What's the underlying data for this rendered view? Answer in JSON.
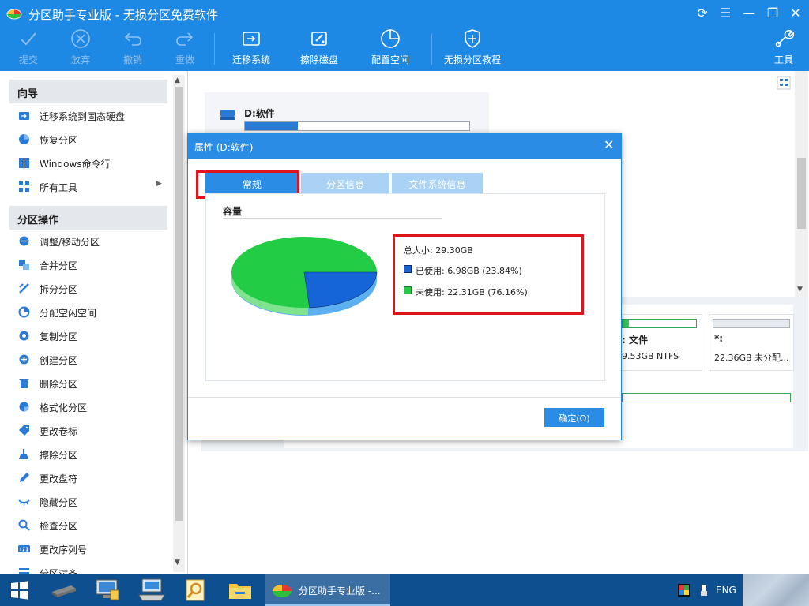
{
  "window": {
    "title": "分区助手专业版 - 无损分区免费软件"
  },
  "toolbar": {
    "items": [
      {
        "label": "提交",
        "icon": "check-icon",
        "disabled": true
      },
      {
        "label": "放弃",
        "icon": "cancel-circle-icon",
        "disabled": true
      },
      {
        "label": "撤销",
        "icon": "undo-icon",
        "disabled": true
      },
      {
        "label": "重做",
        "icon": "redo-icon",
        "disabled": true
      },
      {
        "label": "迁移系统",
        "icon": "migrate-os-icon"
      },
      {
        "label": "擦除磁盘",
        "icon": "wipe-disk-icon"
      },
      {
        "label": "配置空间",
        "icon": "allocate-space-icon"
      },
      {
        "label": "无损分区教程",
        "icon": "shield-icon"
      }
    ],
    "tools_label": "工具"
  },
  "sidebar": {
    "wizard_title": "向导",
    "wizard_items": [
      "迁移系统到固态硬盘",
      "恢复分区",
      "Windows命令行",
      "所有工具"
    ],
    "ops_title": "分区操作",
    "ops_items": [
      "调整/移动分区",
      "合并分区",
      "拆分分区",
      "分配空闲空间",
      "复制分区",
      "创建分区",
      "删除分区",
      "格式化分区",
      "更改卷标",
      "擦除分区",
      "更改盘符",
      "隐藏分区",
      "检查分区",
      "更改序列号",
      "分区对齐"
    ]
  },
  "main": {
    "partition_label": "D:软件",
    "card1": {
      "name": ": 文件",
      "detail": "9.53GB NTFS"
    },
    "card2": {
      "name": "*:",
      "detail": "22.36GB 未分配..."
    }
  },
  "dialog": {
    "title": "属性 (D:软件)",
    "tabs": [
      "常规",
      "分区信息",
      "文件系统信息"
    ],
    "section_title": "容量",
    "total": "总大小: 29.30GB",
    "used": "已使用: 6.98GB (23.84%)",
    "free": "未使用: 22.31GB (76.16%)",
    "ok_label": "确定(O)"
  },
  "chart_data": {
    "type": "pie",
    "categories": [
      "已使用",
      "未使用"
    ],
    "values": [
      6.98,
      22.31
    ],
    "colors": [
      "#1565d8",
      "#22cc44"
    ]
  },
  "taskbar": {
    "active_app_label": "分区助手专业版 -...",
    "lang": "ENG"
  },
  "colors": {
    "accent": "#1e88e5",
    "highlight_red": "#e0141c"
  }
}
